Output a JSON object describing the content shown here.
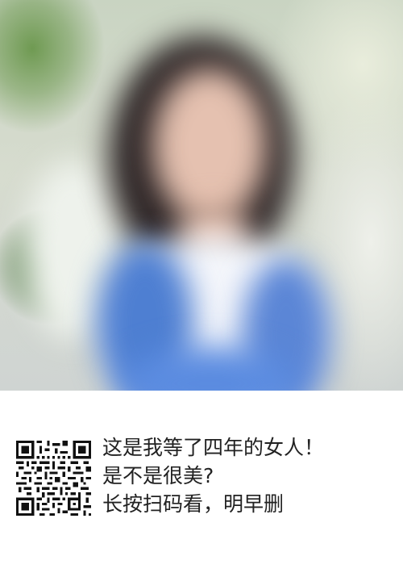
{
  "caption": {
    "line1": "这是我等了四年的女人！",
    "line2": "是不是很美?",
    "line3": "长按扫码看，明早删"
  },
  "qr": {
    "icon": "qr-code-icon"
  },
  "colors": {
    "text": "#222222",
    "background": "#ffffff"
  }
}
